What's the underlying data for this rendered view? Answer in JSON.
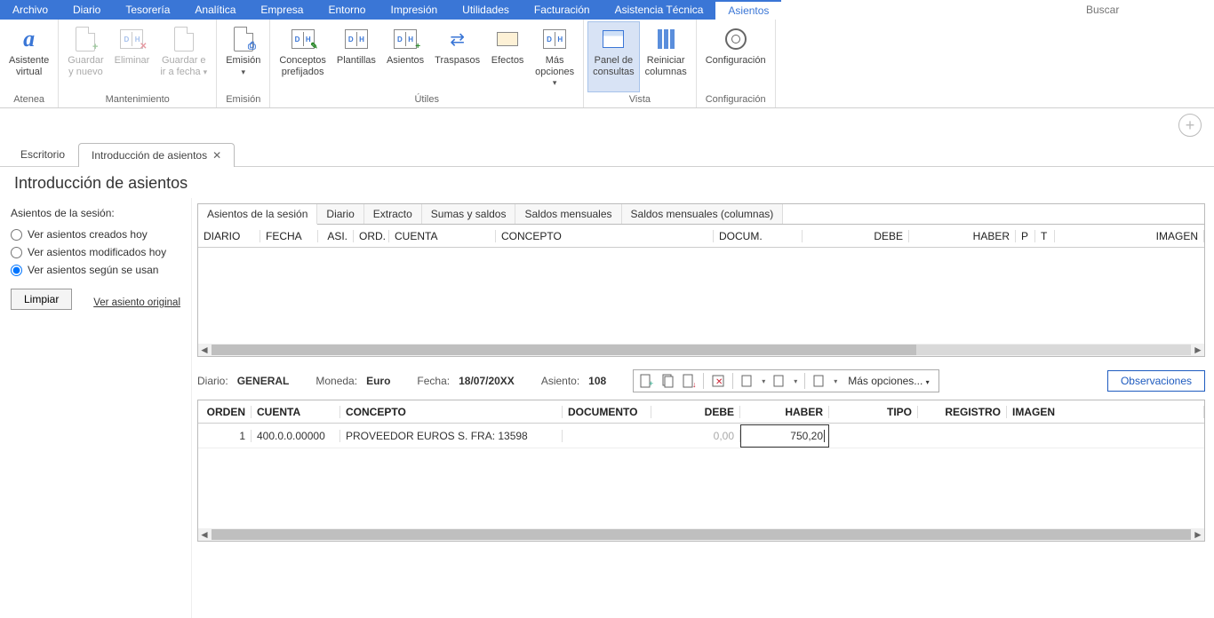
{
  "menu": {
    "items": [
      "Archivo",
      "Diario",
      "Tesorería",
      "Analítica",
      "Empresa",
      "Entorno",
      "Impresión",
      "Utilidades",
      "Facturación",
      "Asistencia Técnica",
      "Asientos"
    ],
    "active_index": 10,
    "search_placeholder": "Buscar"
  },
  "ribbon": {
    "groups": [
      {
        "label": "Atenea",
        "buttons": [
          {
            "label": "Asistente\nvirtual"
          }
        ]
      },
      {
        "label": "Mantenimiento",
        "buttons": [
          {
            "label": "Guardar\ny nuevo",
            "disabled": true
          },
          {
            "label": "Eliminar",
            "disabled": true
          },
          {
            "label": "Guardar e\nir a fecha",
            "disabled": true,
            "dropdown": true
          }
        ]
      },
      {
        "label": "Emisión",
        "buttons": [
          {
            "label": "Emisión",
            "dropdown": true
          }
        ]
      },
      {
        "label": "Útiles",
        "buttons": [
          {
            "label": "Conceptos\nprefijados"
          },
          {
            "label": "Plantillas"
          },
          {
            "label": "Asientos"
          },
          {
            "label": "Traspasos"
          },
          {
            "label": "Efectos"
          },
          {
            "label": "Más\nopciones",
            "dropdown": true
          }
        ]
      },
      {
        "label": "Vista",
        "buttons": [
          {
            "label": "Panel de\nconsultas",
            "active": true
          },
          {
            "label": "Reiniciar\ncolumnas"
          }
        ]
      },
      {
        "label": "Configuración",
        "buttons": [
          {
            "label": "Configuración"
          }
        ]
      }
    ]
  },
  "tabs": {
    "items": [
      "Escritorio",
      "Introducción de asientos"
    ],
    "active_index": 1
  },
  "page_title": "Introducción de asientos",
  "sidebar": {
    "title": "Asientos de la sesión:",
    "radios": [
      "Ver asientos creados hoy",
      "Ver asientos modificados hoy",
      "Ver asientos según se usan"
    ],
    "selected_radio": 2,
    "clean_btn": "Limpiar",
    "link": "Ver asiento original"
  },
  "consult_panel": {
    "tabs": [
      "Asientos de la sesión",
      "Diario",
      "Extracto",
      "Sumas y saldos",
      "Saldos mensuales",
      "Saldos mensuales (columnas)"
    ],
    "active_tab": 0,
    "columns": [
      "DIARIO",
      "FECHA",
      "ASI.",
      "ORD.",
      "CUENTA",
      "CONCEPTO",
      "DOCUM.",
      "DEBE",
      "HABER",
      "P",
      "T",
      "IMAGEN"
    ]
  },
  "infobar": {
    "diario_label": "Diario:",
    "diario_value": "GENERAL",
    "moneda_label": "Moneda:",
    "moneda_value": "Euro",
    "fecha_label": "Fecha:",
    "fecha_value": "18/07/20XX",
    "asiento_label": "Asiento:",
    "asiento_value": "108",
    "more_options": "Más opciones...",
    "observaciones": "Observaciones"
  },
  "entry_grid": {
    "columns": [
      "ORDEN",
      "CUENTA",
      "CONCEPTO",
      "DOCUMENTO",
      "DEBE",
      "HABER",
      "TIPO",
      "REGISTRO",
      "IMAGEN"
    ],
    "row": {
      "orden": "1",
      "cuenta": "400.0.0.00000",
      "concepto": "PROVEEDOR EUROS S. FRA:  13598",
      "documento": "",
      "debe": "0,00",
      "haber": "750,20",
      "tipo": "",
      "registro": "",
      "imagen": ""
    }
  }
}
